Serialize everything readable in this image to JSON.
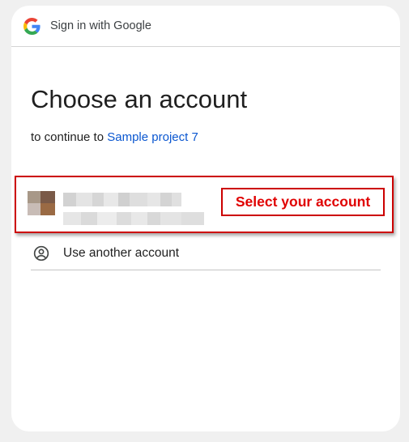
{
  "header": {
    "title": "Sign in with Google",
    "logo_icon": "google-g-logo"
  },
  "main": {
    "title": "Choose an account",
    "subtitle_prefix": "to continue to",
    "project_name": "Sample project 7"
  },
  "account": {
    "name": "",
    "email": "",
    "callout_label": "Select your account",
    "highlight_color": "#cc0000"
  },
  "another_account": {
    "label": "Use another account",
    "icon": "person-circle-icon"
  },
  "colors": {
    "link": "#0b57d0",
    "callout_text": "#e00000"
  }
}
